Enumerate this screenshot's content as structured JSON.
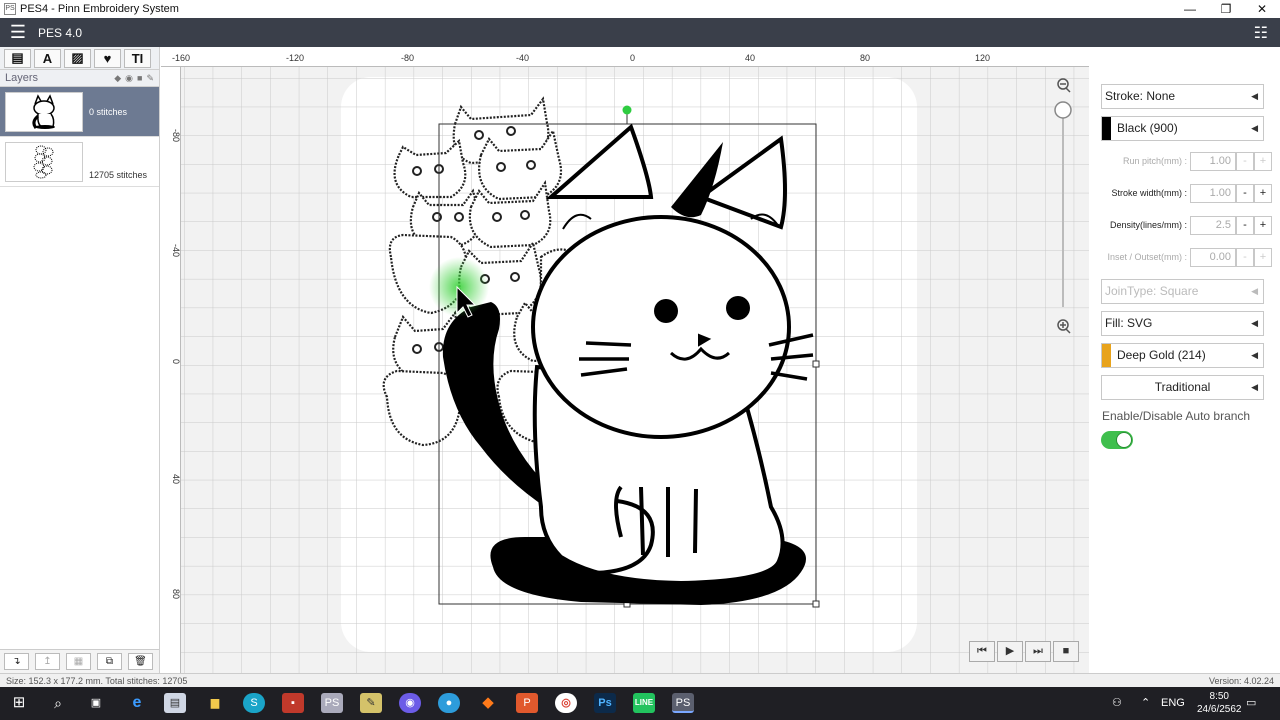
{
  "window": {
    "title": "PES4 - Pinn Embroidery System",
    "minimize": "—",
    "maximize": "❐",
    "close": "✕"
  },
  "appbar": {
    "menu_icon": "☰",
    "version_label": "PES 4.0",
    "panel_icon": "☷"
  },
  "toolbar": {
    "tools": [
      "▤",
      "A",
      "▨",
      "♥",
      "TI"
    ]
  },
  "layers": {
    "header": "Layers",
    "items": [
      {
        "stitches": "0 stitches",
        "selected": true
      },
      {
        "stitches": "12705 stitches",
        "selected": false
      }
    ]
  },
  "layer_actions": [
    "↴",
    "↥",
    "▦",
    "⧉",
    "🗑"
  ],
  "ruler": {
    "top_labels": [
      "-160",
      "-120",
      "-80",
      "-40",
      "0",
      "40",
      "80",
      "120"
    ],
    "left_labels": [
      "-80",
      "-40",
      "0",
      "40",
      "80"
    ]
  },
  "playback": [
    "⏮",
    "▶",
    "⏭",
    "■"
  ],
  "right_panel": {
    "stroke": "Stroke: None",
    "stroke_color": "Black (900)",
    "stroke_color_hex": "#000000",
    "run_pitch_label": "Run pitch(mm) :",
    "run_pitch_value": "1.00",
    "stroke_width_label": "Stroke width(mm) :",
    "stroke_width_value": "1.00",
    "density_label": "Density(lines/mm) :",
    "density_value": "2.5",
    "inset_label": "Inset / Outset(mm) :",
    "inset_value": "0.00",
    "join_type": "JoinType: Square",
    "fill": "Fill: SVG",
    "fill_color": "Deep Gold (214)",
    "fill_color_hex": "#e8a31c",
    "fill_style": "Traditional",
    "auto_branch_label": "Enable/Disable Auto branch",
    "auto_branch_on": true,
    "minus": "-",
    "plus": "+"
  },
  "status": {
    "left": "Size: 152.3 x 177.2 mm.  Total stitches: 12705",
    "right": "Version: 4.02.24"
  },
  "taskbar": {
    "lang": "ENG",
    "time": "8:50",
    "date": "24/6/2562"
  }
}
